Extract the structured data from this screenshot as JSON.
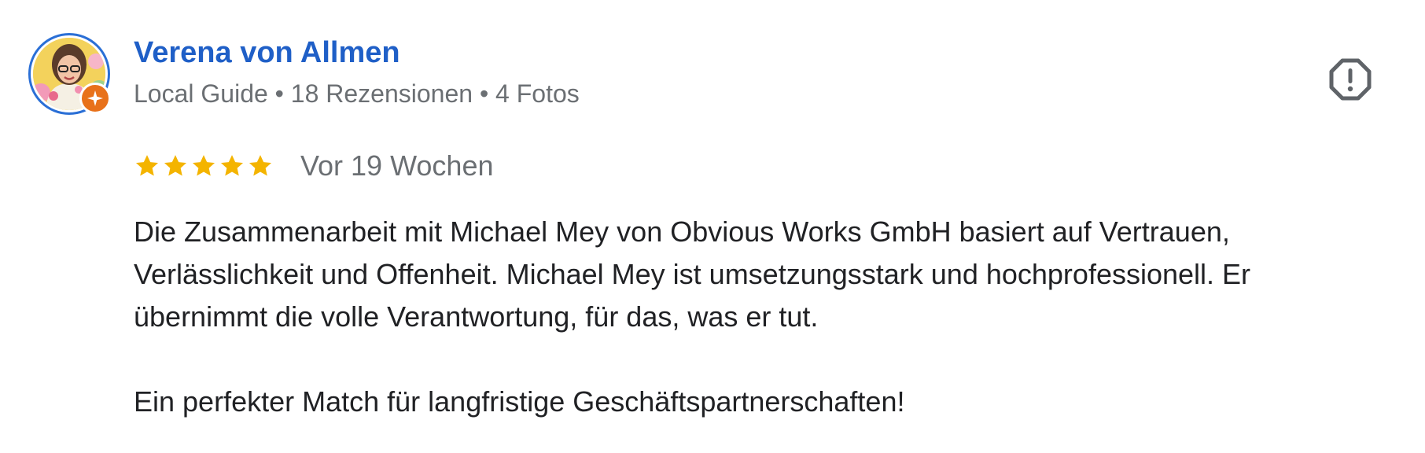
{
  "reviewer": {
    "name": "Verena von Allmen",
    "meta": "Local Guide • 18 Rezensionen • 4 Fotos",
    "avatar_icon": "user-avatar-photo",
    "badge_icon": "local-guide-star-icon"
  },
  "review": {
    "rating": 5,
    "rating_max": 5,
    "time": "Vor 19 Wochen",
    "paragraphs": [
      "Die Zusammenarbeit mit Michael Mey von Obvious Works GmbH basiert auf Vertrauen, Verlässlichkeit und Offenheit. Michael Mey ist umsetzungsstark und hochprofessionell. Er übernimmt die volle Verantwortung, für das, was er tut.",
      "Ein perfekter Match für langfristige Geschäftspartnerschaften!"
    ]
  },
  "actions": {
    "report_icon": "report-octagon-icon"
  },
  "colors": {
    "name": "#1f5fc7",
    "meta": "#6b6f73",
    "star": "#f4b400",
    "avatar_ring": "#2a6fd6",
    "guide_badge": "#e8711a",
    "text": "#202124"
  }
}
